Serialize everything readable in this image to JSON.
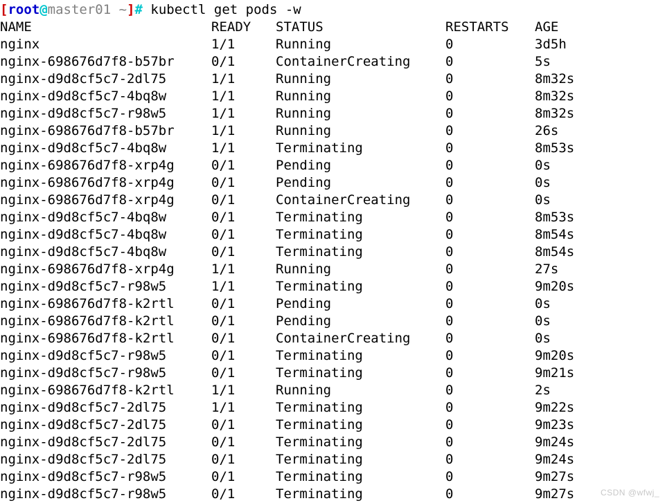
{
  "terminal": {
    "prompt": {
      "open_bracket": "[",
      "user": "root",
      "at": "@",
      "host": "master01 ~",
      "close_bracket": "]",
      "sigil": "#",
      "command": " kubectl get pods -w"
    },
    "colors": {
      "background": "#ffffff",
      "foreground": "#000000",
      "bracket_red": "#cc0000",
      "user_blue": "#0000cc",
      "at_cyan": "#00c5cd",
      "host_gray": "#808080",
      "tilde_green": "#00b000",
      "hash_cyan": "#00c5cd"
    },
    "headers": {
      "name": "NAME",
      "ready": "READY",
      "status": "STATUS",
      "restarts": "RESTARTS",
      "age": "AGE"
    },
    "rows": [
      {
        "name": "nginx",
        "ready": "1/1",
        "status": "Running",
        "restarts": "0",
        "age": "3d5h"
      },
      {
        "name": "nginx-698676d7f8-b57br",
        "ready": "0/1",
        "status": "ContainerCreating",
        "restarts": "0",
        "age": "5s"
      },
      {
        "name": "nginx-d9d8cf5c7-2dl75",
        "ready": "1/1",
        "status": "Running",
        "restarts": "0",
        "age": "8m32s"
      },
      {
        "name": "nginx-d9d8cf5c7-4bq8w",
        "ready": "1/1",
        "status": "Running",
        "restarts": "0",
        "age": "8m32s"
      },
      {
        "name": "nginx-d9d8cf5c7-r98w5",
        "ready": "1/1",
        "status": "Running",
        "restarts": "0",
        "age": "8m32s"
      },
      {
        "name": "nginx-698676d7f8-b57br",
        "ready": "1/1",
        "status": "Running",
        "restarts": "0",
        "age": "26s"
      },
      {
        "name": "nginx-d9d8cf5c7-4bq8w",
        "ready": "1/1",
        "status": "Terminating",
        "restarts": "0",
        "age": "8m53s"
      },
      {
        "name": "nginx-698676d7f8-xrp4g",
        "ready": "0/1",
        "status": "Pending",
        "restarts": "0",
        "age": "0s"
      },
      {
        "name": "nginx-698676d7f8-xrp4g",
        "ready": "0/1",
        "status": "Pending",
        "restarts": "0",
        "age": "0s"
      },
      {
        "name": "nginx-698676d7f8-xrp4g",
        "ready": "0/1",
        "status": "ContainerCreating",
        "restarts": "0",
        "age": "0s"
      },
      {
        "name": "nginx-d9d8cf5c7-4bq8w",
        "ready": "0/1",
        "status": "Terminating",
        "restarts": "0",
        "age": "8m53s"
      },
      {
        "name": "nginx-d9d8cf5c7-4bq8w",
        "ready": "0/1",
        "status": "Terminating",
        "restarts": "0",
        "age": "8m54s"
      },
      {
        "name": "nginx-d9d8cf5c7-4bq8w",
        "ready": "0/1",
        "status": "Terminating",
        "restarts": "0",
        "age": "8m54s"
      },
      {
        "name": "nginx-698676d7f8-xrp4g",
        "ready": "1/1",
        "status": "Running",
        "restarts": "0",
        "age": "27s"
      },
      {
        "name": "nginx-d9d8cf5c7-r98w5",
        "ready": "1/1",
        "status": "Terminating",
        "restarts": "0",
        "age": "9m20s"
      },
      {
        "name": "nginx-698676d7f8-k2rtl",
        "ready": "0/1",
        "status": "Pending",
        "restarts": "0",
        "age": "0s"
      },
      {
        "name": "nginx-698676d7f8-k2rtl",
        "ready": "0/1",
        "status": "Pending",
        "restarts": "0",
        "age": "0s"
      },
      {
        "name": "nginx-698676d7f8-k2rtl",
        "ready": "0/1",
        "status": "ContainerCreating",
        "restarts": "0",
        "age": "0s"
      },
      {
        "name": "nginx-d9d8cf5c7-r98w5",
        "ready": "0/1",
        "status": "Terminating",
        "restarts": "0",
        "age": "9m20s"
      },
      {
        "name": "nginx-d9d8cf5c7-r98w5",
        "ready": "0/1",
        "status": "Terminating",
        "restarts": "0",
        "age": "9m21s"
      },
      {
        "name": "nginx-698676d7f8-k2rtl",
        "ready": "1/1",
        "status": "Running",
        "restarts": "0",
        "age": "2s"
      },
      {
        "name": "nginx-d9d8cf5c7-2dl75",
        "ready": "1/1",
        "status": "Terminating",
        "restarts": "0",
        "age": "9m22s"
      },
      {
        "name": "nginx-d9d8cf5c7-2dl75",
        "ready": "0/1",
        "status": "Terminating",
        "restarts": "0",
        "age": "9m23s"
      },
      {
        "name": "nginx-d9d8cf5c7-2dl75",
        "ready": "0/1",
        "status": "Terminating",
        "restarts": "0",
        "age": "9m24s"
      },
      {
        "name": "nginx-d9d8cf5c7-2dl75",
        "ready": "0/1",
        "status": "Terminating",
        "restarts": "0",
        "age": "9m24s"
      },
      {
        "name": "nginx-d9d8cf5c7-r98w5",
        "ready": "0/1",
        "status": "Terminating",
        "restarts": "0",
        "age": "9m27s"
      },
      {
        "name": "nginx-d9d8cf5c7-r98w5",
        "ready": "0/1",
        "status": "Terminating",
        "restarts": "0",
        "age": "9m27s"
      }
    ],
    "watermark": "CSDN @wfwj_"
  }
}
